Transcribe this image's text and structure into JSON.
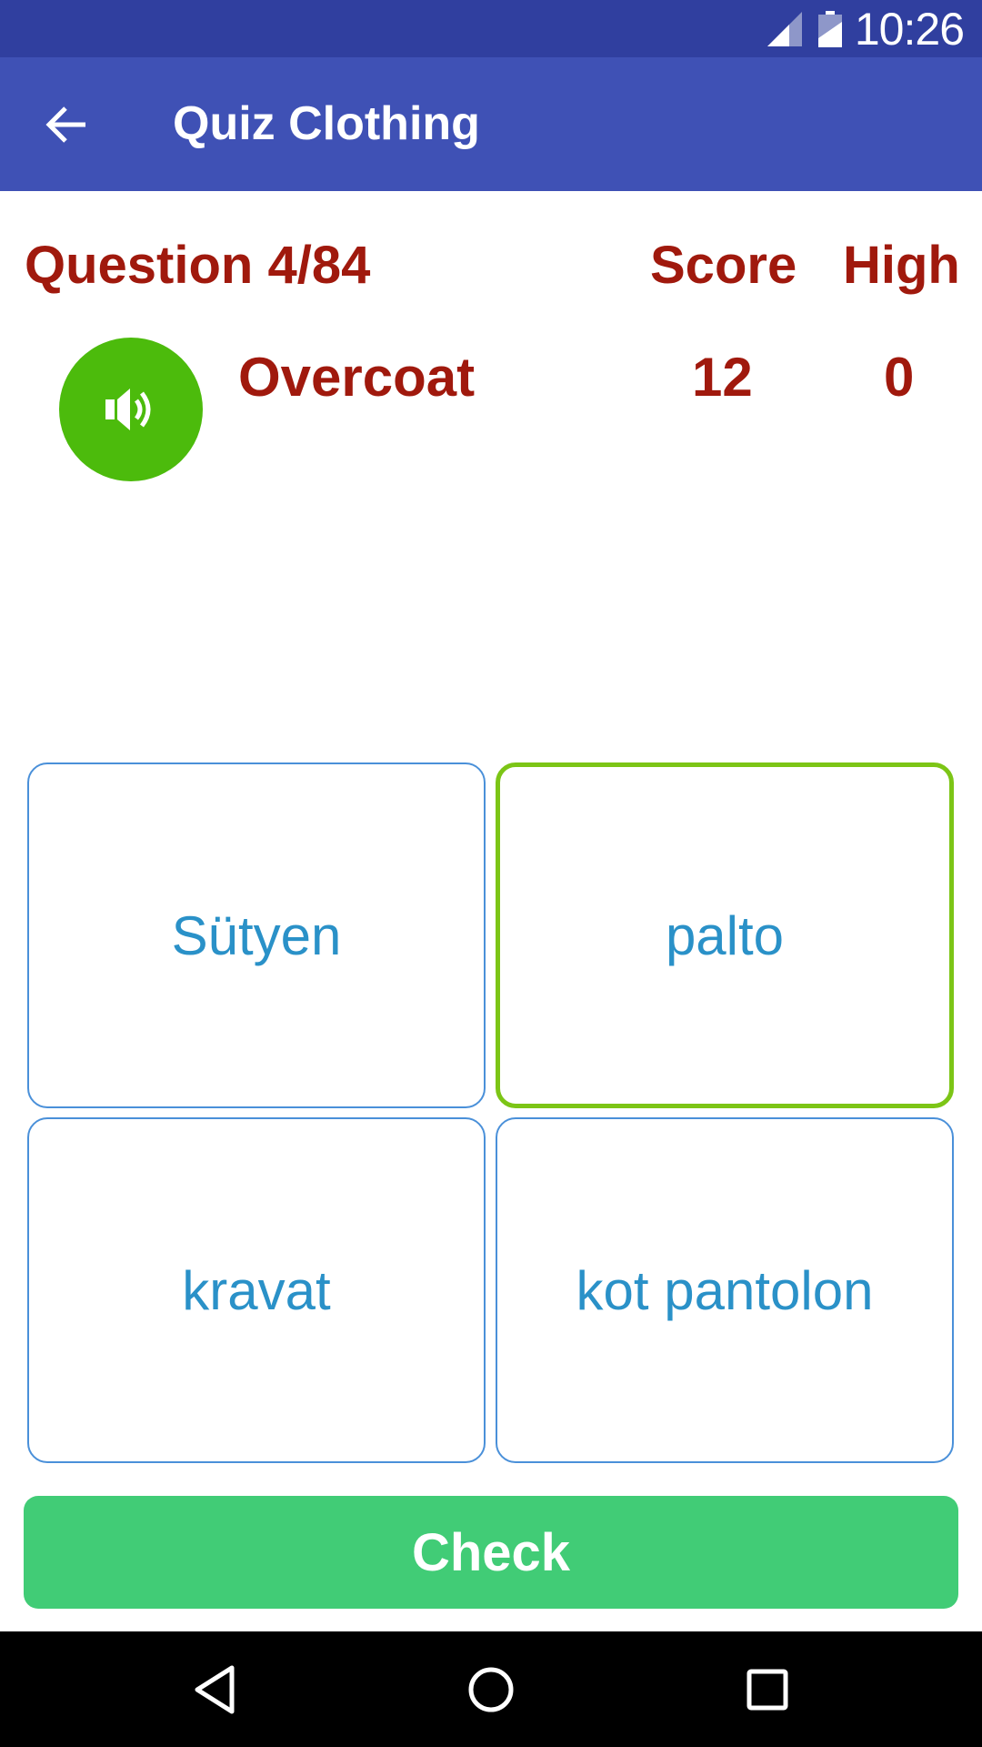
{
  "status_bar": {
    "time": "10:26",
    "background": "#303F9F"
  },
  "app_bar": {
    "title": "Quiz Clothing",
    "back_icon": "arrow-left-icon",
    "background": "#3F51B5"
  },
  "quiz": {
    "question_label": "Question 4/84",
    "score_label": "Score",
    "high_label": "High",
    "word": "Overcoat",
    "score_value": "12",
    "high_value": "0",
    "speaker_icon": "speaker-icon",
    "text_color": "#A0190D"
  },
  "answers": [
    {
      "label": "Sütyen",
      "selected": false
    },
    {
      "label": "palto",
      "selected": true
    },
    {
      "label": "kravat",
      "selected": false
    },
    {
      "label": "kot pantolon",
      "selected": false
    }
  ],
  "check_button": {
    "label": "Check",
    "color": "#41CC76"
  },
  "nav_bar": {
    "icons": [
      "back-triangle-icon",
      "home-circle-icon",
      "recents-square-icon"
    ]
  }
}
